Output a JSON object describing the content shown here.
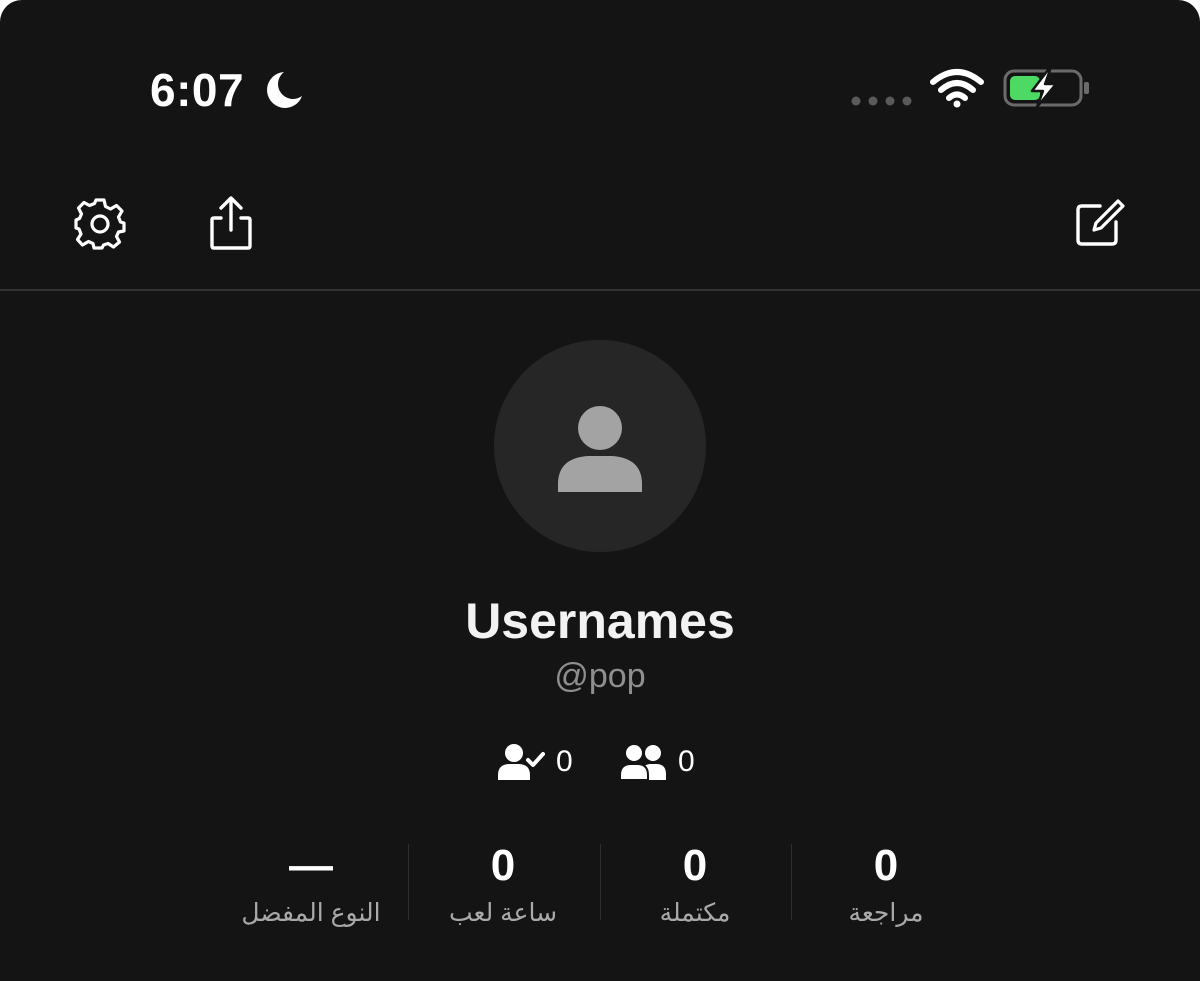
{
  "status_bar": {
    "time": "6:07",
    "icons": [
      "moon-icon",
      "cellular-signal-icon",
      "wifi-icon",
      "battery-charging-icon"
    ],
    "battery_color": "#4cd964"
  },
  "toolbar": {
    "icons": [
      "gear-icon",
      "share-icon",
      "edit-icon"
    ]
  },
  "profile": {
    "avatar_icon": "person-placeholder-icon",
    "display_name": "Usernames",
    "handle": "@pop",
    "following_count": "0",
    "followers_count": "0"
  },
  "stats": [
    {
      "value": "0",
      "label": "مراجعة"
    },
    {
      "value": "0",
      "label": "مكتملة"
    },
    {
      "value": "0",
      "label": "ساعة لعب"
    },
    {
      "value": "—",
      "label": "النوع المفضل"
    }
  ],
  "colors": {
    "background": "#141414",
    "avatar_circle": "#262626",
    "avatar_glyph": "#a3a3a3",
    "secondary_text": "#8e8e8e"
  }
}
